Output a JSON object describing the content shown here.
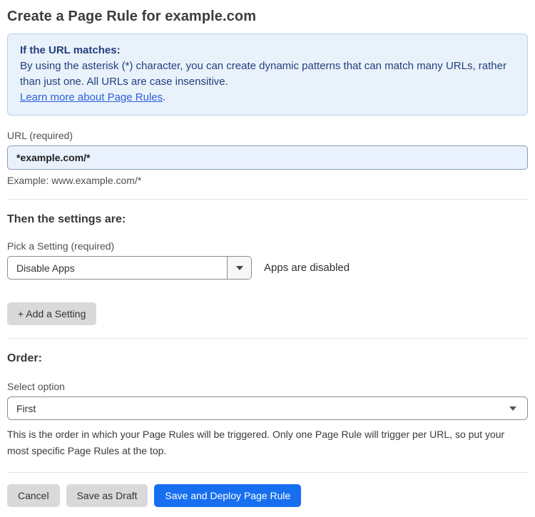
{
  "page": {
    "title": "Create a Page Rule for example.com"
  },
  "info_box": {
    "heading": "If the URL matches:",
    "body": "By using the asterisk (*) character, you can create dynamic patterns that can match many URLs, rather than just one. All URLs are case insensitive.",
    "link_label": "Learn more about Page Rules",
    "link_suffix": "."
  },
  "url_field": {
    "label": "URL (required)",
    "value": "*example.com/*",
    "hint": "Example: www.example.com/*"
  },
  "settings_section": {
    "heading": "Then the settings are:",
    "setting_label": "Pick a Setting (required)",
    "setting_value": "Disable Apps",
    "setting_status": "Apps are disabled",
    "add_setting_label": "+ Add a Setting"
  },
  "order_section": {
    "heading": "Order:",
    "select_label": "Select option",
    "select_value": "First",
    "description": "This is the order in which your Page Rules will be triggered. Only one Page Rule will trigger per URL, so put your most specific Page Rules at the top."
  },
  "footer": {
    "cancel_label": "Cancel",
    "save_draft_label": "Save as Draft",
    "save_deploy_label": "Save and Deploy Page Rule"
  },
  "colors": {
    "info_box_bg": "#e9f1fb",
    "info_box_border": "#b9d3ee",
    "info_text": "#24407c",
    "link": "#2b62d9",
    "url_input_bg": "#e9f1fc",
    "gray_button_bg": "#d9d9d9",
    "primary_button_bg": "#176ff0"
  }
}
